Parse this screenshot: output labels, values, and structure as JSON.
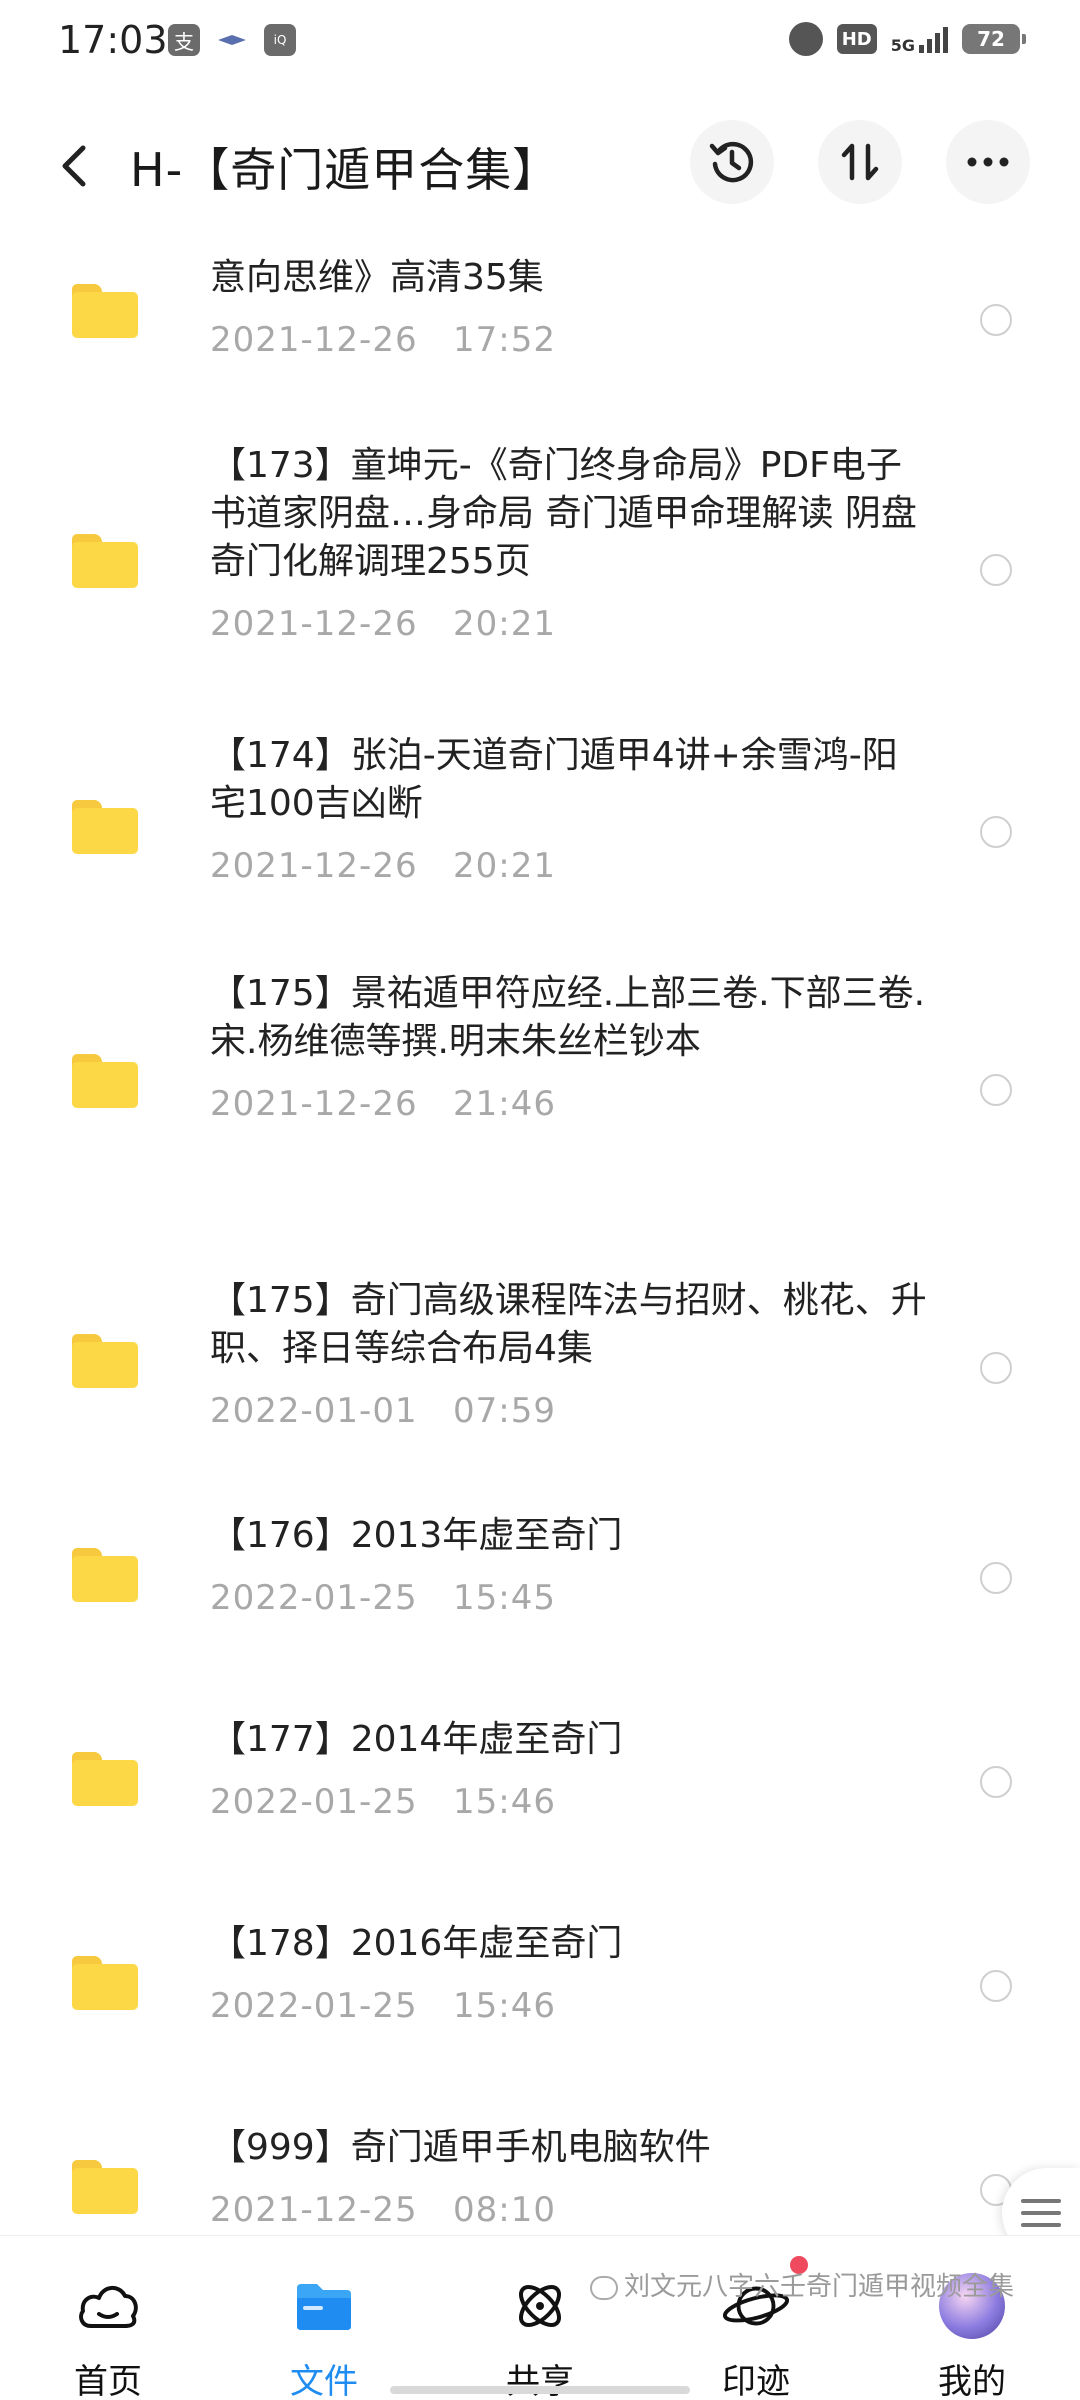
{
  "status_bar": {
    "time": "17:03",
    "app_icon_1": "支",
    "hd": "HD",
    "network": "5G",
    "battery": "72"
  },
  "header": {
    "title": "H-【奇门遁甲合集】"
  },
  "files": [
    {
      "title": "意向思维》高清35集",
      "date": "2021-12-26   17:52"
    },
    {
      "title": "【173】童坤元-《奇门终身命局》PDF电子书道家阴盘…身命局 奇门遁甲命理解读 阴盘奇门化解调理255页",
      "date": "2021-12-26   20:21"
    },
    {
      "title": "【174】张泊-天道奇门遁甲4讲+余雪鸿-阳宅100吉凶断",
      "date": "2021-12-26   20:21"
    },
    {
      "title": "【175】景祐遁甲符应经.上部三卷.下部三卷.宋.杨维德等撰.明末朱丝栏钞本",
      "date": "2021-12-26   21:46"
    },
    {
      "title": "【175】奇门高级课程阵法与招财、桃花、升职、择日等综合布局4集",
      "date": "2022-01-01   07:59"
    },
    {
      "title": "【176】2013年虚至奇门",
      "date": "2022-01-25   15:45"
    },
    {
      "title": "【177】2014年虚至奇门",
      "date": "2022-01-25   15:46"
    },
    {
      "title": "【178】2016年虚至奇门",
      "date": "2022-01-25   15:46"
    },
    {
      "title": "【999】奇门遁甲手机电脑软件",
      "date": "2021-12-25   08:10"
    }
  ],
  "bottom_nav": {
    "items": [
      {
        "label": "首页",
        "icon": "cloud-icon"
      },
      {
        "label": "文件",
        "icon": "folder-icon"
      },
      {
        "label": "共享",
        "icon": "share-orbit-icon"
      },
      {
        "label": "印迹",
        "icon": "planet-icon"
      },
      {
        "label": "我的",
        "icon": "avatar"
      }
    ],
    "active_color": "#1e8cf0"
  },
  "watermark": "刘文元八字六壬奇门遁甲视频全集"
}
